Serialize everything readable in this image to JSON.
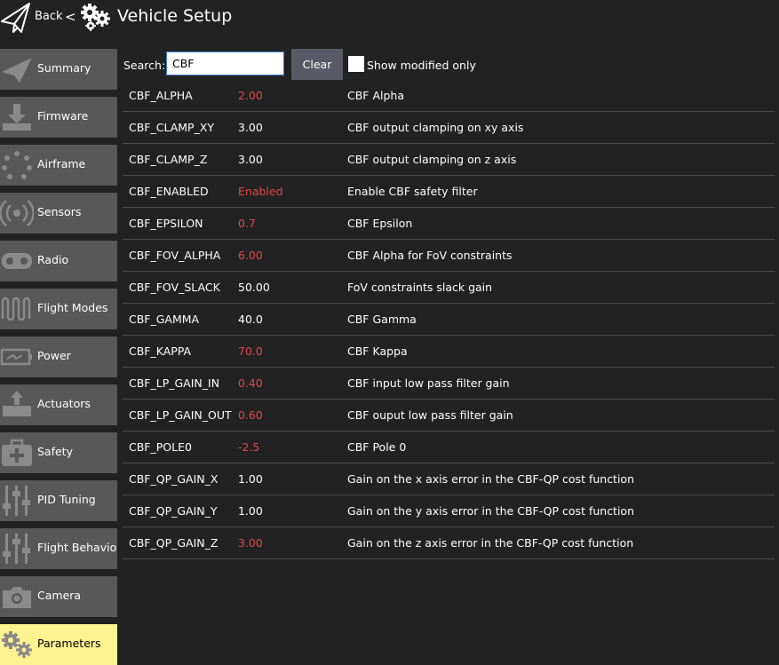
{
  "header": {
    "back_label": "Back",
    "separator": "<",
    "title": "Vehicle Setup"
  },
  "sidebar": {
    "items": [
      {
        "label": "Summary",
        "icon": "paper-plane-icon",
        "active": false
      },
      {
        "label": "Firmware",
        "icon": "download-icon",
        "active": false
      },
      {
        "label": "Airframe",
        "icon": "airframe-icon",
        "active": false
      },
      {
        "label": "Sensors",
        "icon": "radio-waves-icon",
        "active": false
      },
      {
        "label": "Radio",
        "icon": "remote-control-icon",
        "active": false
      },
      {
        "label": "Flight Modes",
        "icon": "waveform-icon",
        "active": false
      },
      {
        "label": "Power",
        "icon": "battery-icon",
        "active": false
      },
      {
        "label": "Actuators",
        "icon": "actuator-icon",
        "active": false
      },
      {
        "label": "Safety",
        "icon": "first-aid-icon",
        "active": false
      },
      {
        "label": "PID Tuning",
        "icon": "sliders-icon",
        "active": false
      },
      {
        "label": "Flight Behavior",
        "icon": "sliders-icon",
        "active": false
      },
      {
        "label": "Camera",
        "icon": "camera-icon",
        "active": false
      },
      {
        "label": "Parameters",
        "icon": "gears-icon",
        "active": true
      }
    ]
  },
  "search": {
    "label": "Search:",
    "value": "CBF",
    "clear_label": "Clear",
    "modified_only_label": "Show modified only",
    "modified_only_checked": false
  },
  "colors": {
    "background": "#222222",
    "sidebar_item": "#585858",
    "sidebar_active": "#fff291",
    "modified_value": "#e0464f",
    "clear_button": "#5a5a66"
  },
  "params": [
    {
      "name": "CBF_ALPHA",
      "value": "2.00",
      "modified": true,
      "description": "CBF Alpha"
    },
    {
      "name": "CBF_CLAMP_XY",
      "value": "3.00",
      "modified": false,
      "description": "CBF output clamping on xy axis"
    },
    {
      "name": "CBF_CLAMP_Z",
      "value": "3.00",
      "modified": false,
      "description": "CBF output clamping on z axis"
    },
    {
      "name": "CBF_ENABLED",
      "value": "Enabled",
      "modified": true,
      "description": "Enable CBF safety filter"
    },
    {
      "name": "CBF_EPSILON",
      "value": "0.7",
      "modified": true,
      "description": "CBF Epsilon"
    },
    {
      "name": "CBF_FOV_ALPHA",
      "value": "6.00",
      "modified": true,
      "description": "CBF Alpha for FoV constraints"
    },
    {
      "name": "CBF_FOV_SLACK",
      "value": "50.00",
      "modified": false,
      "description": "FoV constraints slack gain"
    },
    {
      "name": "CBF_GAMMA",
      "value": "40.0",
      "modified": false,
      "description": "CBF Gamma"
    },
    {
      "name": "CBF_KAPPA",
      "value": "70.0",
      "modified": true,
      "description": "CBF Kappa"
    },
    {
      "name": "CBF_LP_GAIN_IN",
      "value": "0.40",
      "modified": true,
      "description": "CBF input low pass filter gain"
    },
    {
      "name": "CBF_LP_GAIN_OUT",
      "value": "0.60",
      "modified": true,
      "description": "CBF ouput low pass filter gain"
    },
    {
      "name": "CBF_POLE0",
      "value": "-2.5",
      "modified": true,
      "description": "CBF Pole 0"
    },
    {
      "name": "CBF_QP_GAIN_X",
      "value": "1.00",
      "modified": false,
      "description": "Gain on the x axis error in the CBF-QP cost function"
    },
    {
      "name": "CBF_QP_GAIN_Y",
      "value": "1.00",
      "modified": false,
      "description": "Gain on the y axis error in the CBF-QP cost function"
    },
    {
      "name": "CBF_QP_GAIN_Z",
      "value": "3.00",
      "modified": true,
      "description": "Gain on the z axis error in the CBF-QP cost function"
    }
  ]
}
